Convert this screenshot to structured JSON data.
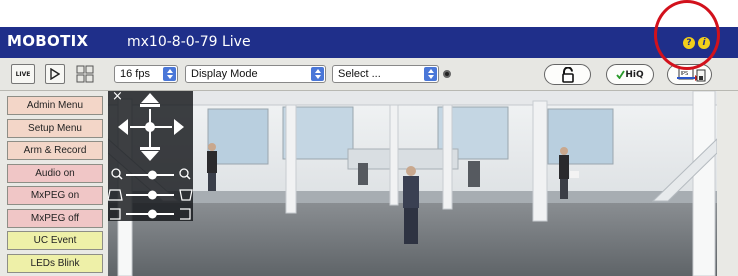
{
  "header": {
    "brand": "MOBOTIX",
    "camera_title": "mx10-8-0-79 Live",
    "help_icon": "?",
    "info_icon": "i"
  },
  "toolbar": {
    "live_label": "LIVE",
    "fps_value": "16 fps",
    "display_mode_value": "Display Mode",
    "select_value": "Select ...",
    "hiq_label": "HiQ",
    "ips_label": "IPS"
  },
  "sidebar": {
    "items": [
      {
        "label": "Admin Menu",
        "color": "#f3d6c8"
      },
      {
        "label": "Setup Menu",
        "color": "#f3d6c8"
      },
      {
        "label": "Arm & Record",
        "color": "#f3d6c8"
      },
      {
        "label": "Audio on",
        "color": "#f0c6c6"
      },
      {
        "label": "MxPEG on",
        "color": "#f0c6c6"
      },
      {
        "label": "MxPEG off",
        "color": "#f0c6c6"
      },
      {
        "label": "UC Event",
        "color": "#eef0a8"
      },
      {
        "label": "LEDs Blink",
        "color": "#eef0a8"
      }
    ]
  },
  "video": {
    "close_label": "×",
    "zoom_level": 0.55,
    "brightness_level": 0.55,
    "rotate_level": 0.55
  },
  "colors": {
    "titlebar": "#1f2f8a",
    "highlight_circle": "#d2111c",
    "help_icon": "#f2cf1a"
  }
}
